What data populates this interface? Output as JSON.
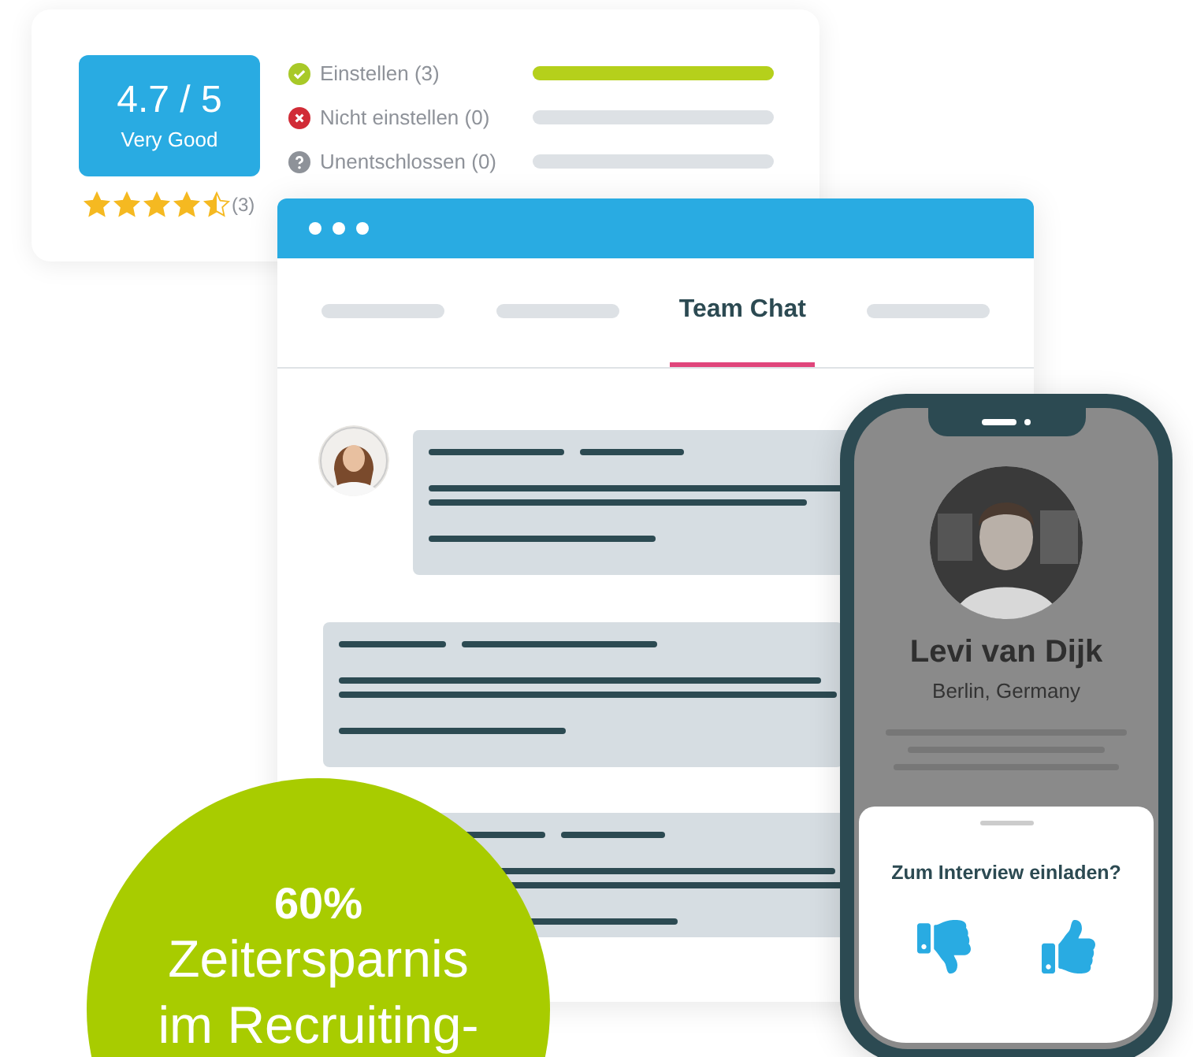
{
  "rating": {
    "score": "4.7 / 5",
    "verdict": "Very Good",
    "stars": 4.5,
    "count": "(3)"
  },
  "votes": [
    {
      "kind": "yes",
      "label": "Einstellen (3)",
      "level": 1
    },
    {
      "kind": "no",
      "label": "Nicht einstellen (0)",
      "level": 0
    },
    {
      "kind": "unsure",
      "label": "Unentschlossen (0)",
      "level": 0
    }
  ],
  "chat": {
    "tabs": [
      {
        "kind": "placeholder",
        "selected": false
      },
      {
        "kind": "placeholder",
        "selected": false
      },
      {
        "kind": "label",
        "label": "Team Chat",
        "selected": true
      },
      {
        "kind": "placeholder",
        "selected": false
      }
    ]
  },
  "profile": {
    "name": "Levi van Dijk",
    "location": "Berlin, Germany",
    "prompt": "Zum Interview einladen?"
  },
  "badge": {
    "figure": "60%",
    "lines": [
      "Zeitersparnis",
      "im Recruiting-"
    ]
  }
}
